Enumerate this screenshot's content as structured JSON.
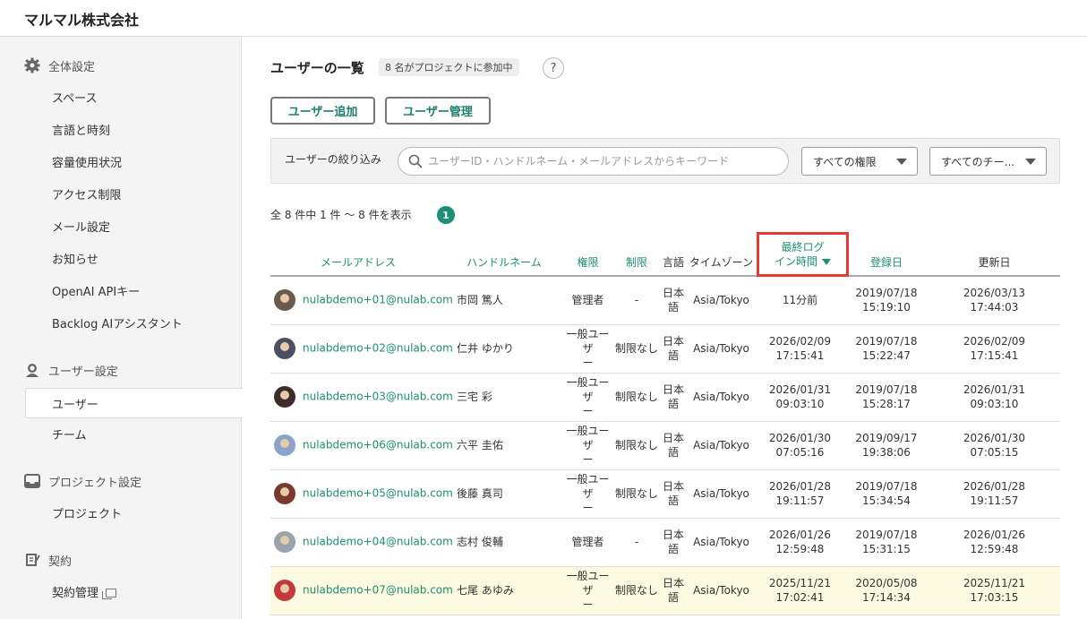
{
  "org_name": "マルマル株式会社",
  "sidebar": {
    "sections": [
      {
        "title": "全体設定",
        "icon": "gear-icon",
        "items": [
          "スペース",
          "言語と時刻",
          "容量使用状況",
          "アクセス制限",
          "メール設定",
          "お知らせ",
          "OpenAI APIキー",
          "Backlog AIアシスタント"
        ]
      },
      {
        "title": "ユーザー設定",
        "icon": "user-icon",
        "items": [
          "ユーザー",
          "チーム"
        ]
      },
      {
        "title": "プロジェクト設定",
        "icon": "inbox-icon",
        "items": [
          "プロジェクト"
        ]
      },
      {
        "title": "契約",
        "icon": "contract-icon",
        "items": [
          "契約管理"
        ]
      }
    ],
    "active_item": "ユーザー"
  },
  "main": {
    "title": "ユーザーの一覧",
    "count_badge": "8 名がプロジェクトに参加中",
    "help": "?",
    "buttons": {
      "add_user": "ユーザー追加",
      "manage_users": "ユーザー管理"
    }
  },
  "filter": {
    "label": "ユーザーの絞り込み",
    "search_placeholder": "ユーザーID・ハンドルネーム・メールアドレスからキーワード",
    "role_select": "すべての権限",
    "team_select": "すべてのチー..."
  },
  "pagination": {
    "summary": "全 8 件中 1 件 〜 8 件を表示",
    "current_page": "1"
  },
  "table": {
    "headers": {
      "email": "メールアドレス",
      "handle": "ハンドルネーム",
      "role": "権限",
      "restriction": "制限",
      "language": "言語",
      "timezone": "タイムゾーン",
      "last_login_line1": "最終ログ",
      "last_login_line2": "イン時間",
      "registered": "登録日",
      "updated": "更新日"
    },
    "rows": [
      {
        "email": "nulabdemo+01@nulab.com",
        "handle": "市岡 篤人",
        "role": "管理者",
        "restriction": "-",
        "lang1": "日本",
        "lang2": "語",
        "tz": "Asia/Tokyo",
        "login1": "11分前",
        "login2": "",
        "reg1": "2019/07/18",
        "reg2": "15:19:10",
        "upd1": "2026/03/13",
        "upd2": "17:44:03",
        "avatar_color": "#6b5a4e"
      },
      {
        "email": "nulabdemo+02@nulab.com",
        "handle": "仁井 ゆかり",
        "role": "一般ユーザ",
        "role2": "ー",
        "restriction": "制限なし",
        "lang1": "日本",
        "lang2": "語",
        "tz": "Asia/Tokyo",
        "login1": "2026/02/09",
        "login2": "17:15:41",
        "reg1": "2019/07/18",
        "reg2": "15:22:47",
        "upd1": "2026/02/09",
        "upd2": "17:15:41",
        "avatar_color": "#4a4f63"
      },
      {
        "email": "nulabdemo+03@nulab.com",
        "handle": "三宅 彩",
        "role": "一般ユーザ",
        "role2": "ー",
        "restriction": "制限なし",
        "lang1": "日本",
        "lang2": "語",
        "tz": "Asia/Tokyo",
        "login1": "2026/01/31",
        "login2": "09:03:10",
        "reg1": "2019/07/18",
        "reg2": "15:28:17",
        "upd1": "2026/01/31",
        "upd2": "09:03:10",
        "avatar_color": "#3b2d2a"
      },
      {
        "email": "nulabdemo+06@nulab.com",
        "handle": "六平 圭佑",
        "role": "一般ユーザ",
        "role2": "ー",
        "restriction": "制限なし",
        "lang1": "日本",
        "lang2": "語",
        "tz": "Asia/Tokyo",
        "login1": "2026/01/30",
        "login2": "07:05:16",
        "reg1": "2019/09/17",
        "reg2": "19:38:06",
        "upd1": "2026/01/30",
        "upd2": "07:05:15",
        "avatar_color": "#8aa3c7"
      },
      {
        "email": "nulabdemo+05@nulab.com",
        "handle": "後藤 真司",
        "role": "一般ユーザ",
        "role2": "ー",
        "restriction": "制限なし",
        "lang1": "日本",
        "lang2": "語",
        "tz": "Asia/Tokyo",
        "login1": "2026/01/28",
        "login2": "19:11:57",
        "reg1": "2019/07/18",
        "reg2": "15:34:54",
        "upd1": "2026/01/28",
        "upd2": "19:11:57",
        "avatar_color": "#7a3b2e"
      },
      {
        "email": "nulabdemo+04@nulab.com",
        "handle": "志村 俊輔",
        "role": "管理者",
        "restriction": "-",
        "lang1": "日本",
        "lang2": "語",
        "tz": "Asia/Tokyo",
        "login1": "2026/01/26",
        "login2": "12:59:48",
        "reg1": "2019/07/18",
        "reg2": "15:31:15",
        "upd1": "2026/01/26",
        "upd2": "12:59:48",
        "avatar_color": "#9aa4ad"
      },
      {
        "email": "nulabdemo+07@nulab.com",
        "handle": "七尾 あゆみ",
        "role": "一般ユーザ",
        "role2": "ー",
        "restriction": "制限なし",
        "lang1": "日本",
        "lang2": "語",
        "tz": "Asia/Tokyo",
        "login1": "2025/11/21",
        "login2": "17:02:41",
        "reg1": "2020/05/08",
        "reg2": "17:14:34",
        "upd1": "2025/11/21",
        "upd2": "17:03:15",
        "avatar_color": "#c23a3a",
        "highlighted": true
      }
    ]
  },
  "colors": {
    "accent": "#1d8f73",
    "highlight_box": "#e53935",
    "row_highlight": "#fcfae0"
  }
}
